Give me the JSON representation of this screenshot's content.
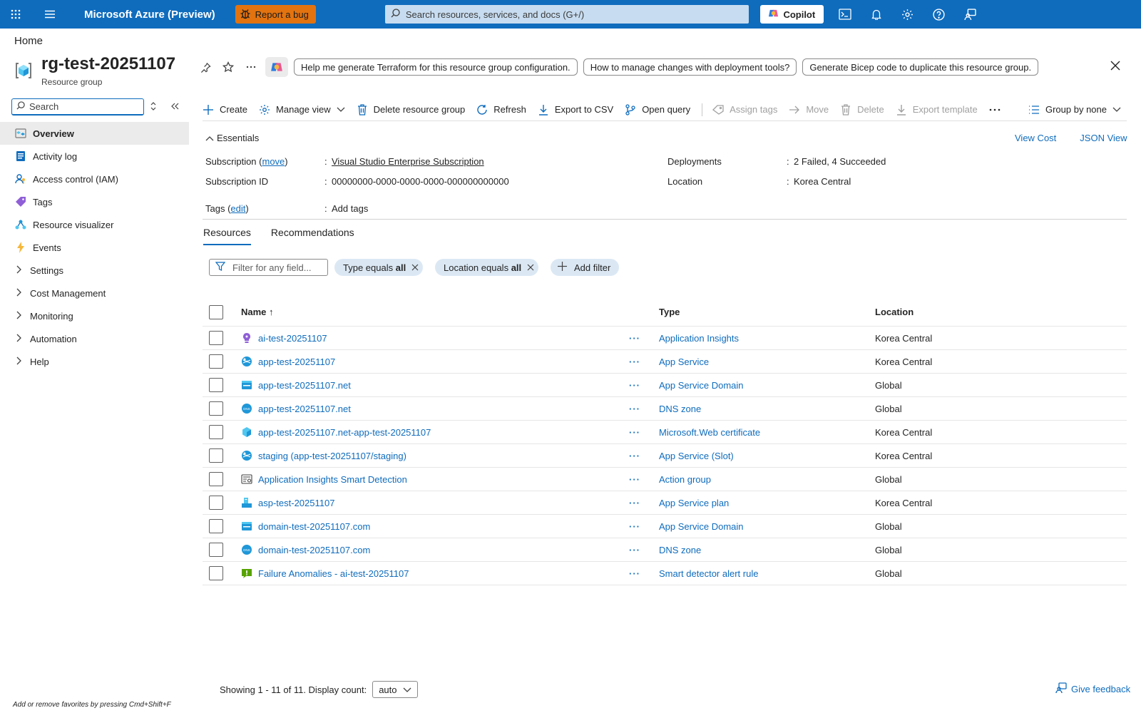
{
  "topbar": {
    "brand": "Microsoft Azure (Preview)",
    "report_bug": "Report a bug",
    "search_placeholder": "Search resources, services, and docs (G+/)",
    "copilot": "Copilot",
    "color": "#0f6cbd"
  },
  "breadcrumb": "Home",
  "header": {
    "title": "rg-test-20251107",
    "subtitle": "Resource group",
    "prompts": [
      "Help me generate Terraform for this resource group configuration.",
      "How to manage changes with deployment tools?",
      "Generate Bicep code to duplicate this resource group."
    ]
  },
  "sidebar": {
    "search_placeholder": "Search",
    "items": [
      {
        "label": "Overview",
        "icon": "overview-icon"
      },
      {
        "label": "Activity log",
        "icon": "activity-log-icon"
      },
      {
        "label": "Access control (IAM)",
        "icon": "iam-icon"
      },
      {
        "label": "Tags",
        "icon": "tag-icon"
      },
      {
        "label": "Resource visualizer",
        "icon": "visualizer-icon"
      },
      {
        "label": "Events",
        "icon": "lightning-icon"
      }
    ],
    "groups": [
      "Settings",
      "Cost Management",
      "Monitoring",
      "Automation",
      "Help"
    ],
    "favorites_hint": "Add or remove favorites by pressing Cmd+Shift+F"
  },
  "commands": {
    "create": "Create",
    "manage_view": "Manage view",
    "delete_rg": "Delete resource group",
    "refresh": "Refresh",
    "export_csv": "Export to CSV",
    "open_query": "Open query",
    "assign_tags": "Assign tags",
    "move": "Move",
    "delete": "Delete",
    "export_template": "Export template",
    "group_by": "Group by none"
  },
  "essentials": {
    "toggle": "Essentials",
    "view_cost": "View Cost",
    "json_view": "JSON View",
    "subscription_label": "Subscription",
    "subscription_move": "move",
    "subscription_value": "Visual Studio Enterprise Subscription",
    "subscription_id_label": "Subscription ID",
    "subscription_id_value": "00000000-0000-0000-0000-000000000000",
    "deployments_label": "Deployments",
    "deployments_value": "2 Failed, 4 Succeeded",
    "location_label": "Location",
    "location_value": "Korea Central",
    "tags_label": "Tags",
    "tags_edit": "edit",
    "tags_value": "Add tags"
  },
  "tabs": [
    "Resources",
    "Recommendations"
  ],
  "filters": {
    "placeholder": "Filter for any field...",
    "type_prefix": "Type ",
    "type_op": "equals",
    "type_value": "all",
    "location_prefix": "Location ",
    "location_op": "equals",
    "location_value": "all",
    "add_filter": "Add filter"
  },
  "table": {
    "headers": {
      "name": "Name ↑",
      "type": "Type",
      "location": "Location"
    },
    "rows": [
      {
        "name": "ai-test-20251107",
        "type": "Application Insights",
        "location": "Korea Central",
        "icon": "app-insights-icon"
      },
      {
        "name": "app-test-20251107",
        "type": "App Service",
        "location": "Korea Central",
        "icon": "app-service-icon"
      },
      {
        "name": "app-test-20251107.net",
        "type": "App Service Domain",
        "location": "Global",
        "icon": "domain-icon"
      },
      {
        "name": "app-test-20251107.net",
        "type": "DNS zone",
        "location": "Global",
        "icon": "dns-zone-icon"
      },
      {
        "name": "app-test-20251107.net-app-test-20251107",
        "type": "Microsoft.Web certificate",
        "location": "Korea Central",
        "icon": "certificate-icon"
      },
      {
        "name": "staging (app-test-20251107/staging)",
        "type": "App Service (Slot)",
        "location": "Korea Central",
        "icon": "app-service-icon"
      },
      {
        "name": "Application Insights Smart Detection",
        "type": "Action group",
        "location": "Global",
        "icon": "action-group-icon"
      },
      {
        "name": "asp-test-20251107",
        "type": "App Service plan",
        "location": "Korea Central",
        "icon": "app-service-plan-icon"
      },
      {
        "name": "domain-test-20251107.com",
        "type": "App Service Domain",
        "location": "Global",
        "icon": "domain-icon"
      },
      {
        "name": "domain-test-20251107.com",
        "type": "DNS zone",
        "location": "Global",
        "icon": "dns-zone-icon"
      },
      {
        "name": "Failure Anomalies - ai-test-20251107",
        "type": "Smart detector alert rule",
        "location": "Global",
        "icon": "alert-rule-icon"
      }
    ]
  },
  "footer": {
    "showing": "Showing 1 - 11 of 11. Display count:",
    "display_count": "auto",
    "feedback": "Give feedback"
  }
}
